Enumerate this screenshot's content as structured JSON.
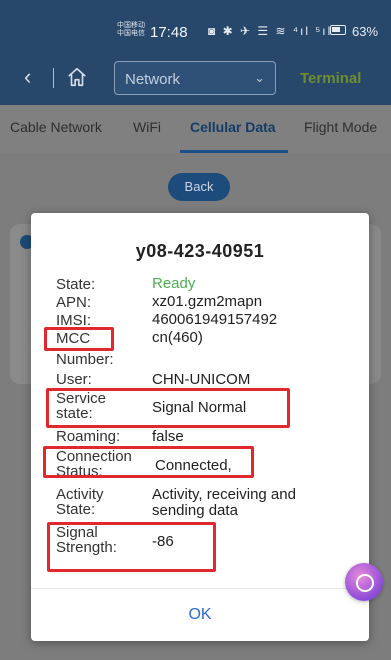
{
  "status_bar": {
    "carrier_1": "中国移动",
    "carrier_2": "中国电信",
    "time": "17:48",
    "icons": "◙ ✱ ✈ ☰ ≋ ⁴ıl ⁵ıl",
    "battery": "63%"
  },
  "header": {
    "back_icon": "chevron-left",
    "home_icon": "home",
    "select_value": "Network",
    "select_caret": "chevron-down",
    "right_label": "Terminal"
  },
  "tabs": [
    {
      "label": "Cable Network"
    },
    {
      "label": "WiFi"
    },
    {
      "label": "Cellular Data"
    },
    {
      "label": "Flight Mode"
    }
  ],
  "back_button": "Back",
  "dialog": {
    "title": "y08-423-40951",
    "fields": [
      {
        "label": "State:",
        "value": "Ready"
      },
      {
        "label": "APN:",
        "value": "xz01.gzm2mapn"
      },
      {
        "label": "IMSI:",
        "value": "460061949157492"
      },
      {
        "label": "MCC",
        "value": "cn(460)"
      },
      {
        "label": "Number:",
        "value": ""
      },
      {
        "label": "User:",
        "value": "CHN-UNICOM"
      },
      {
        "label": "Service state:",
        "value": "Signal Normal"
      },
      {
        "label": "Roaming:",
        "value": "false"
      },
      {
        "label": "Connection Status:",
        "value": "Connected,"
      },
      {
        "label": "Activity State:",
        "value": "Activity, receiving and sending data"
      },
      {
        "label": "Signal Strength:",
        "value": "-86"
      }
    ],
    "ok_label": "OK"
  },
  "colors": {
    "accent": "#1c4f86",
    "ready": "#4caf50",
    "highlight": "#e0282e",
    "ok": "#2d6bd6"
  }
}
